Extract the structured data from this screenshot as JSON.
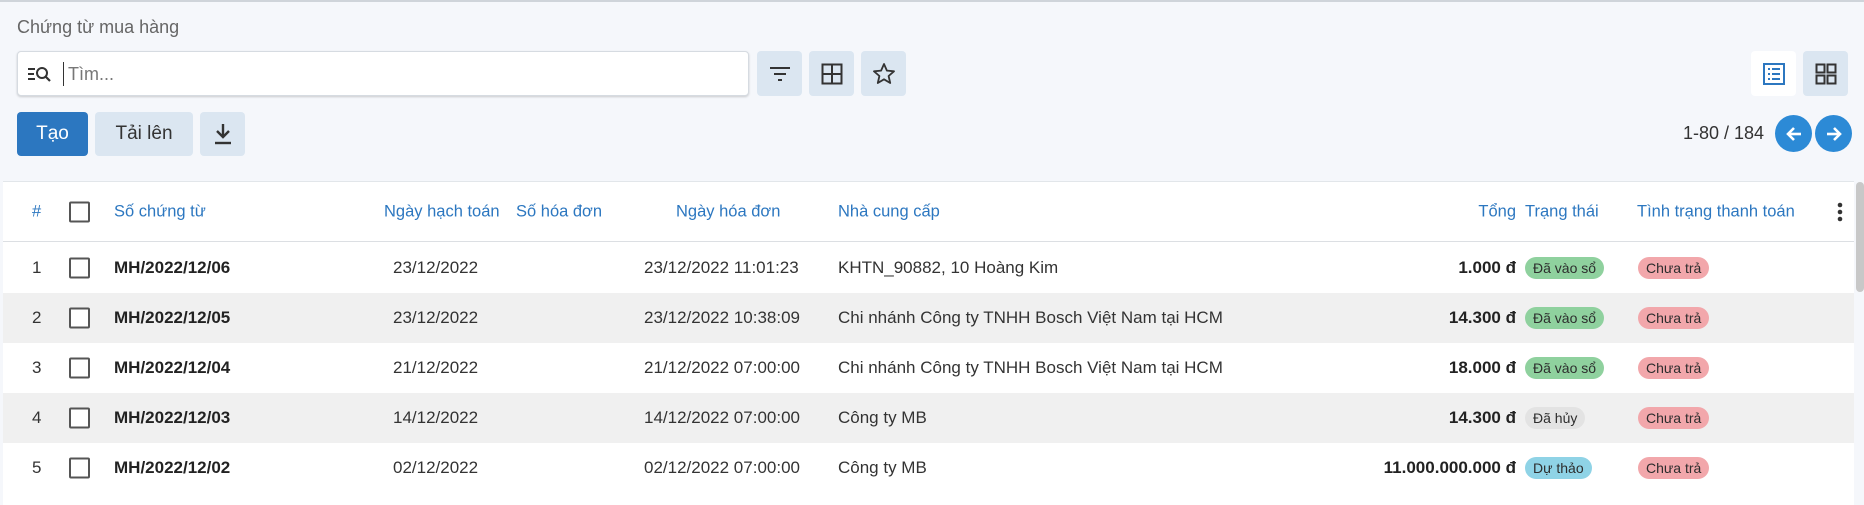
{
  "page": {
    "title": "Chứng từ mua hàng"
  },
  "search": {
    "placeholder": "Tìm..."
  },
  "toolbar": {
    "create_label": "Tạo",
    "upload_label": "Tải lên"
  },
  "pager": {
    "text": "1-80 / 184"
  },
  "colors": {
    "primary": "#2c77c0",
    "pager_button": "#2c8ad6",
    "header_text": "#2c77c0"
  },
  "icons": [
    "search-list-icon",
    "filter-icon",
    "group-by-icon",
    "favorite-star-icon",
    "download-icon",
    "list-view-icon",
    "kanban-view-icon",
    "arrow-left-icon",
    "arrow-right-icon",
    "more-vertical-icon"
  ],
  "table": {
    "columns": {
      "index": "#",
      "number": "Số chứng từ",
      "accounting_date": "Ngày hạch toán",
      "invoice_number": "Số hóa đơn",
      "invoice_date": "Ngày hóa đơn",
      "vendor": "Nhà cung cấp",
      "total": "Tổng",
      "status": "Trạng thái",
      "payment_status": "Tình trạng thanh toán"
    },
    "rows": [
      {
        "index": "1",
        "number": "MH/2022/12/06",
        "accounting_date": "23/12/2022",
        "invoice_number": "",
        "invoice_date": "23/12/2022 11:01:23",
        "vendor": "KHTN_90882, 10 Hoàng Kim",
        "total": "1.000 đ",
        "status": "Đã vào sổ",
        "status_color": "#8fd19e",
        "payment_status": "Chưa trả",
        "payment_color": "#f2a7ab"
      },
      {
        "index": "2",
        "number": "MH/2022/12/05",
        "accounting_date": "23/12/2022",
        "invoice_number": "",
        "invoice_date": "23/12/2022 10:38:09",
        "vendor": "Chi nhánh Công ty TNHH Bosch Việt Nam tại HCM",
        "total": "14.300 đ",
        "status": "Đã vào sổ",
        "status_color": "#8fd19e",
        "payment_status": "Chưa trả",
        "payment_color": "#f2a7ab"
      },
      {
        "index": "3",
        "number": "MH/2022/12/04",
        "accounting_date": "21/12/2022",
        "invoice_number": "",
        "invoice_date": "21/12/2022 07:00:00",
        "vendor": "Chi nhánh Công ty TNHH Bosch Việt Nam tại HCM",
        "total": "18.000 đ",
        "status": "Đã vào sổ",
        "status_color": "#8fd19e",
        "payment_status": "Chưa trả",
        "payment_color": "#f2a7ab"
      },
      {
        "index": "4",
        "number": "MH/2022/12/03",
        "accounting_date": "14/12/2022",
        "invoice_number": "",
        "invoice_date": "14/12/2022 07:00:00",
        "vendor": "Công ty MB",
        "total": "14.300 đ",
        "status": "Đã hủy",
        "status_color": "#e3e3e3",
        "payment_status": "Chưa trả",
        "payment_color": "#f2a7ab"
      },
      {
        "index": "5",
        "number": "MH/2022/12/02",
        "accounting_date": "02/12/2022",
        "invoice_number": "",
        "invoice_date": "02/12/2022 07:00:00",
        "vendor": "Công ty MB",
        "total": "11.000.000.000 đ",
        "status": "Dự thảo",
        "status_color": "#8fd3e6",
        "payment_status": "Chưa trả",
        "payment_color": "#f2a7ab"
      }
    ]
  }
}
